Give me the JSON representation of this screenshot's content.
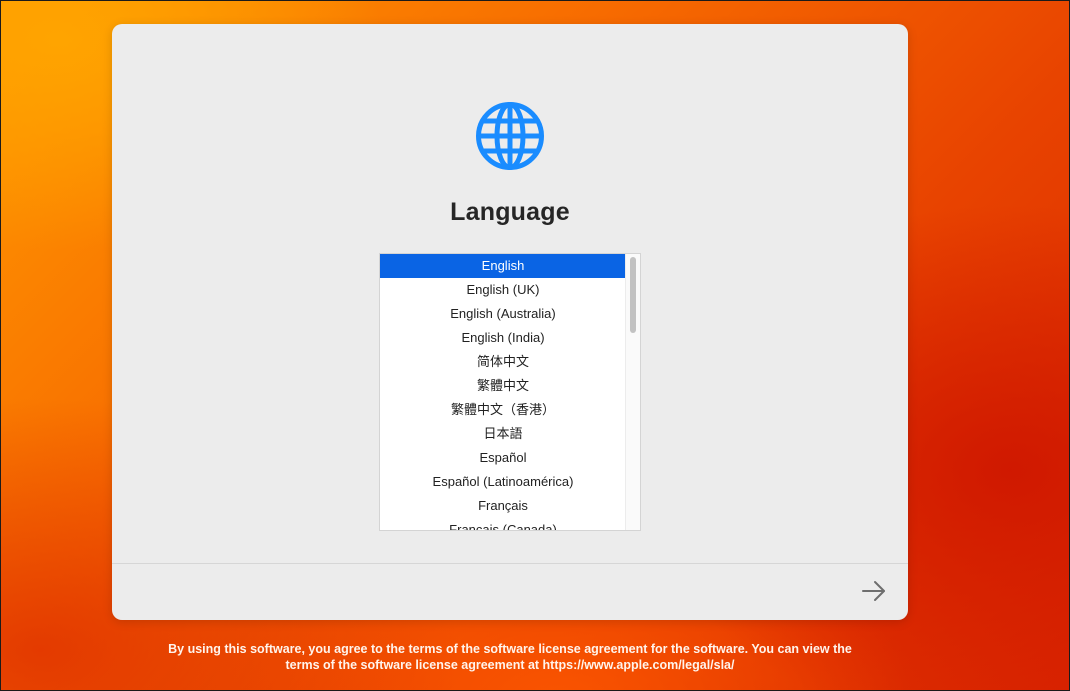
{
  "window": {
    "title": "Language"
  },
  "icons": {
    "header": "globe-icon",
    "continue": "arrow-right-icon"
  },
  "colors": {
    "accent": "#0a64e4",
    "globe": "#1a8cff"
  },
  "language_list": {
    "selected": "English",
    "items": [
      "English",
      "English (UK)",
      "English (Australia)",
      "English (India)",
      "简体中文",
      "繁體中文",
      "繁體中文（香港）",
      "日本語",
      "Español",
      "Español (Latinoamérica)",
      "Français",
      "Français (Canada)"
    ]
  },
  "footer": {
    "line1": "By using this software, you agree to the terms of the software license agreement for the software. You can view the",
    "line2": "terms of the software license agreement at https://www.apple.com/legal/sla/"
  }
}
